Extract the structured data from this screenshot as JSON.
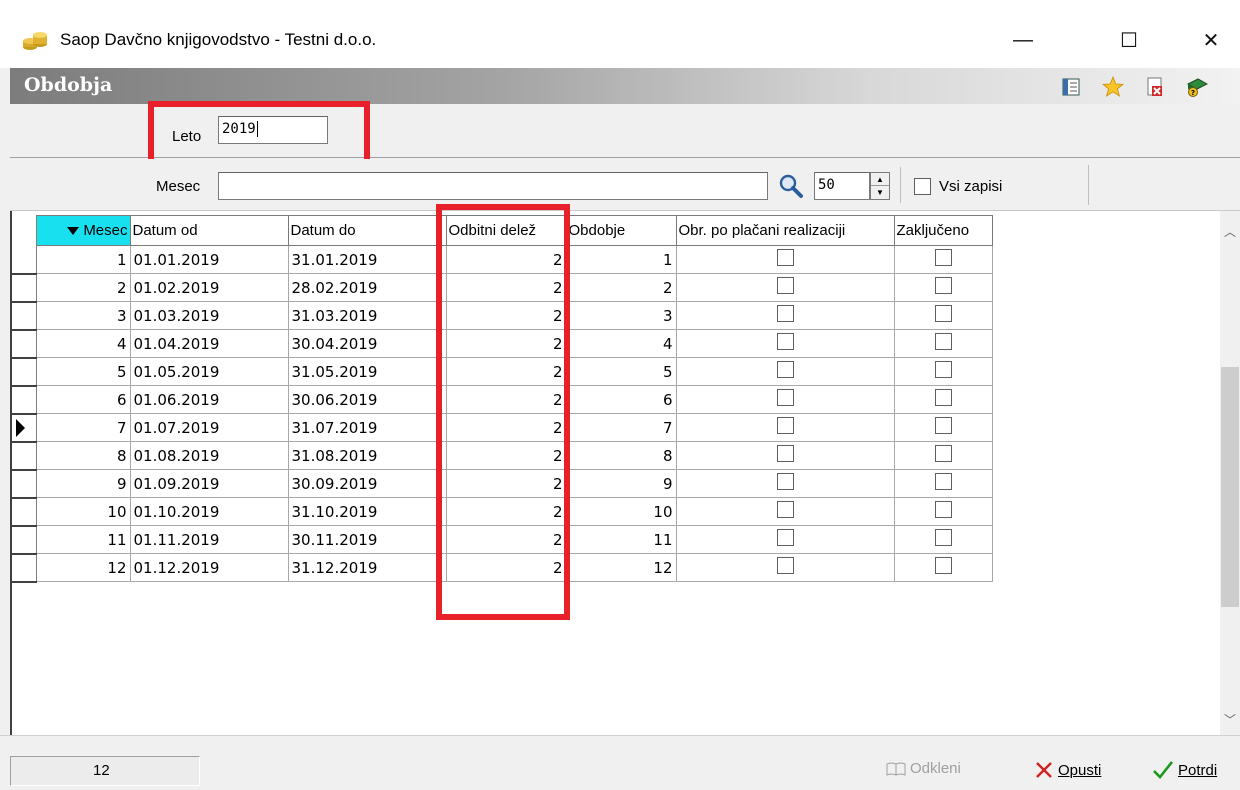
{
  "window": {
    "title": "Saop Davčno knjigovodstvo - Testni d.o.o.",
    "min": "—",
    "max": "☐",
    "close": "✕"
  },
  "header": {
    "title": "Obdobja"
  },
  "filter": {
    "leto_label": "Leto",
    "leto_value": "2019",
    "mesec_label": "Mesec",
    "mesec_value": "",
    "page_size": "50",
    "vsi_zapisi_label": "Vsi zapisi"
  },
  "columns": {
    "mesec": "Mesec",
    "datum_od": "Datum od",
    "datum_do": "Datum do",
    "odbitni_delez": "Odbitni delež",
    "obdobje": "Obdobje",
    "obr_po_placani": "Obr. po plačani realizaciji",
    "zakljuceno": "Zaključeno"
  },
  "rows": [
    {
      "mesec": "1",
      "od": "01.01.2019",
      "do": "31.01.2019",
      "delez": "2",
      "obdobje": "1"
    },
    {
      "mesec": "2",
      "od": "01.02.2019",
      "do": "28.02.2019",
      "delez": "2",
      "obdobje": "2"
    },
    {
      "mesec": "3",
      "od": "01.03.2019",
      "do": "31.03.2019",
      "delez": "2",
      "obdobje": "3"
    },
    {
      "mesec": "4",
      "od": "01.04.2019",
      "do": "30.04.2019",
      "delez": "2",
      "obdobje": "4"
    },
    {
      "mesec": "5",
      "od": "01.05.2019",
      "do": "31.05.2019",
      "delez": "2",
      "obdobje": "5"
    },
    {
      "mesec": "6",
      "od": "01.06.2019",
      "do": "30.06.2019",
      "delez": "2",
      "obdobje": "6"
    },
    {
      "mesec": "7",
      "od": "01.07.2019",
      "do": "31.07.2019",
      "delez": "2",
      "obdobje": "7"
    },
    {
      "mesec": "8",
      "od": "01.08.2019",
      "do": "31.08.2019",
      "delez": "2",
      "obdobje": "8"
    },
    {
      "mesec": "9",
      "od": "01.09.2019",
      "do": "30.09.2019",
      "delez": "2",
      "obdobje": "9"
    },
    {
      "mesec": "10",
      "od": "01.10.2019",
      "do": "31.10.2019",
      "delez": "2",
      "obdobje": "10"
    },
    {
      "mesec": "11",
      "od": "01.11.2019",
      "do": "30.11.2019",
      "delez": "2",
      "obdobje": "11"
    },
    {
      "mesec": "12",
      "od": "01.12.2019",
      "do": "31.12.2019",
      "delez": "2",
      "obdobje": "12"
    }
  ],
  "status": {
    "record_count": "12"
  },
  "buttons": {
    "odkleni": "Odkleni",
    "opusti": "Opusti",
    "potrdi": "Potrdi"
  },
  "colors": {
    "highlight_red": "#e8202a",
    "sort_header": "#19e0ee"
  }
}
